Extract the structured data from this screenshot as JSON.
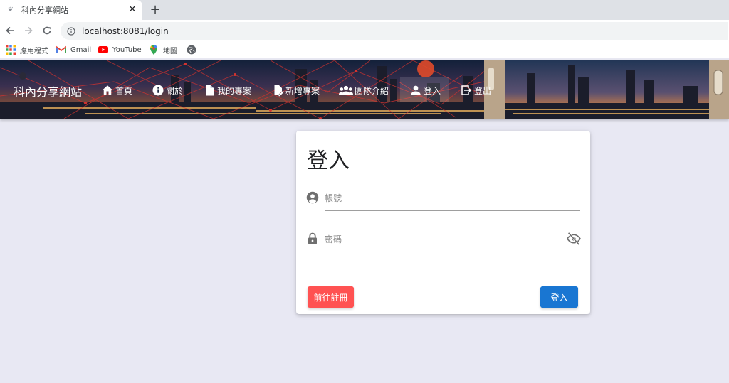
{
  "browser": {
    "tab_title": "科內分享網站",
    "tab_close": "✕",
    "new_tab": "+",
    "url": "localhost:8081/login",
    "bookmarks": [
      {
        "label": "應用程式",
        "icon": "apps-grid-icon"
      },
      {
        "label": "Gmail",
        "icon": "gmail-icon"
      },
      {
        "label": "YouTube",
        "icon": "youtube-icon"
      },
      {
        "label": "地圖",
        "icon": "maps-pin-icon"
      },
      {
        "label": "",
        "icon": "globe-icon"
      }
    ]
  },
  "header": {
    "brand": "科內分享網站",
    "nav": [
      {
        "label": "首頁",
        "icon": "home-icon"
      },
      {
        "label": "關於",
        "icon": "info-icon"
      },
      {
        "label": "我的專案",
        "icon": "document-icon"
      },
      {
        "label": "新增專案",
        "icon": "edit-document-icon"
      },
      {
        "label": "團隊介紹",
        "icon": "group-icon"
      },
      {
        "label": "登入",
        "icon": "person-icon"
      },
      {
        "label": "登出",
        "icon": "logout-icon"
      }
    ],
    "active_nav": "登入"
  },
  "login": {
    "title": "登入",
    "username_placeholder": "帳號",
    "username_value": "",
    "password_placeholder": "密碼",
    "password_value": "",
    "register_button": "前往註冊",
    "login_button": "登入"
  },
  "colors": {
    "page_background": "#e8e8f3",
    "register_button": "#ff5252",
    "login_button": "#1976d2",
    "card_background": "#ffffff"
  }
}
